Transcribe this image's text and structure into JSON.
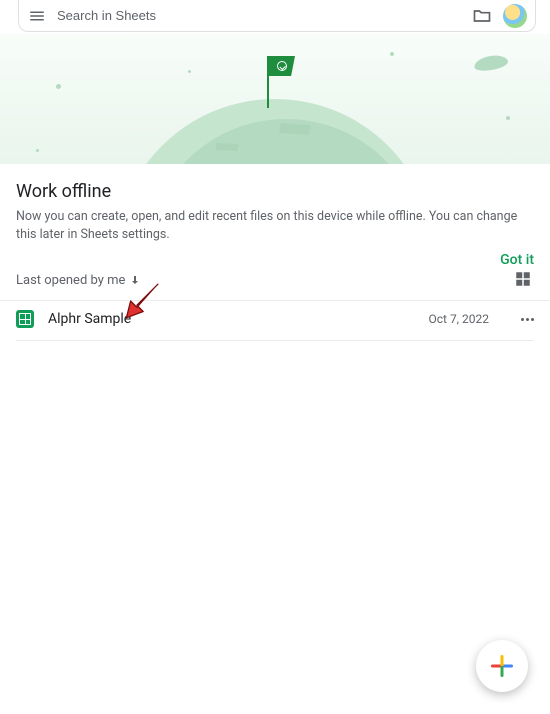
{
  "search": {
    "placeholder": "Search in Sheets"
  },
  "banner": {
    "title": "Work offline",
    "body": "Now you can create, open, and edit recent files on this device while offline. You can change this later in Sheets settings.",
    "confirm": "Got it"
  },
  "list": {
    "sort_label": "Last opened by me",
    "files": [
      {
        "name": "Alphr Sample",
        "date": "Oct 7, 2022"
      }
    ]
  },
  "colors": {
    "accent": "#0f9d58"
  }
}
